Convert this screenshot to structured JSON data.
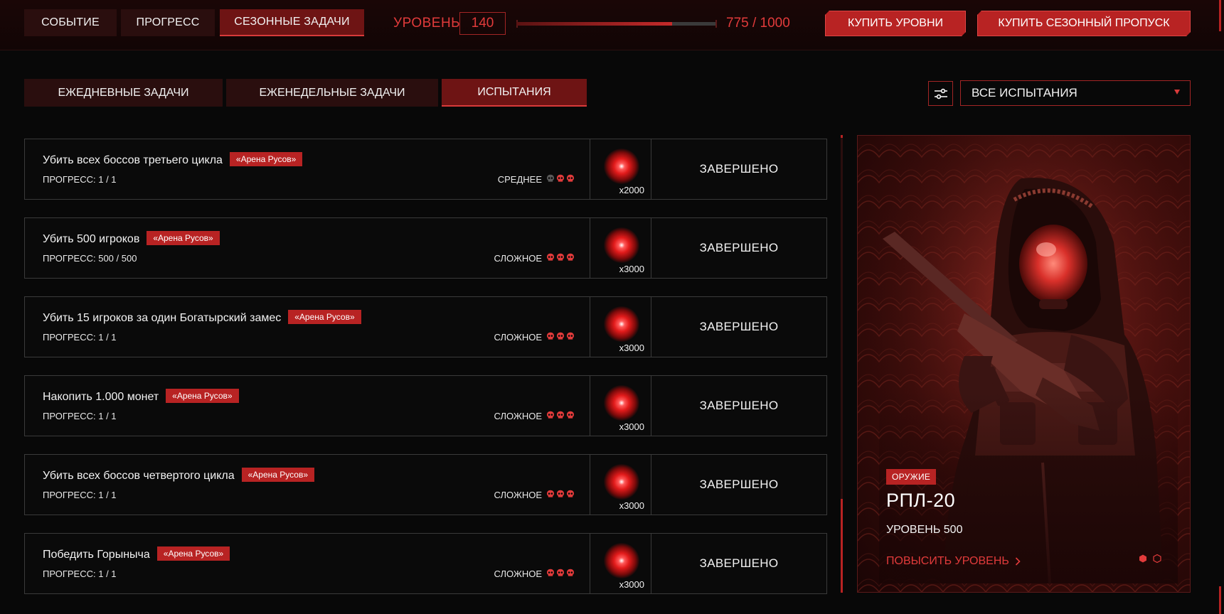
{
  "top_tabs": [
    {
      "label": "СОБЫТИЕ"
    },
    {
      "label": "ПРОГРЕСС"
    },
    {
      "label": "СЕЗОННЫЕ ЗАДАЧИ"
    }
  ],
  "level": {
    "label": "УРОВЕНЬ",
    "value": "140",
    "xp_text": "775 / 1000",
    "xp_fraction": 0.775
  },
  "buy_buttons": {
    "levels": "КУПИТЬ УРОВНИ",
    "pass": "КУПИТЬ СЕЗОННЫЙ ПРОПУСК"
  },
  "sub_tabs": [
    {
      "label": "ЕЖЕДНЕВНЫЕ ЗАДАЧИ"
    },
    {
      "label": "ЕЖЕНЕДЕЛЬНЫЕ ЗАДАЧИ"
    },
    {
      "label": "ИСПЫТАНИЯ"
    }
  ],
  "filter": {
    "icon": "sliders-icon",
    "dropdown_value": "ВСЕ ИСПЫТАНИЯ"
  },
  "tasks": [
    {
      "title": "Убить всех боссов третьего цикла",
      "tag": "«Арена Русов»",
      "progress": "ПРОГРЕСС: 1 / 1",
      "difficulty": "СРЕДНЕЕ",
      "skulls_filled": 2,
      "reward": "x2000",
      "status": "ЗАВЕРШЕНО"
    },
    {
      "title": "Убить 500 игроков",
      "tag": "«Арена Русов»",
      "progress": "ПРОГРЕСС: 500 / 500",
      "difficulty": "СЛОЖНОЕ",
      "skulls_filled": 3,
      "reward": "x3000",
      "status": "ЗАВЕРШЕНО"
    },
    {
      "title": "Убить 15 игроков за один Богатырский замес",
      "tag": "«Арена Русов»",
      "progress": "ПРОГРЕСС: 1 / 1",
      "difficulty": "СЛОЖНОЕ",
      "skulls_filled": 3,
      "reward": "x3000",
      "status": "ЗАВЕРШЕНО"
    },
    {
      "title": "Накопить 1.000 монет",
      "tag": "«Арена Русов»",
      "progress": "ПРОГРЕСС: 1 / 1",
      "difficulty": "СЛОЖНОЕ",
      "skulls_filled": 3,
      "reward": "x3000",
      "status": "ЗАВЕРШЕНО"
    },
    {
      "title": "Убить всех боссов четвертого цикла",
      "tag": "«Арена Русов»",
      "progress": "ПРОГРЕСС: 1 / 1",
      "difficulty": "СЛОЖНОЕ",
      "skulls_filled": 3,
      "reward": "x3000",
      "status": "ЗАВЕРШЕНО"
    },
    {
      "title": "Победить Горыныча",
      "tag": "«Арена Русов»",
      "progress": "ПРОГРЕСС: 1 / 1",
      "difficulty": "СЛОЖНОЕ",
      "skulls_filled": 3,
      "reward": "x3000",
      "status": "ЗАВЕРШЕНО"
    }
  ],
  "promo": {
    "badge": "ОРУЖИЕ",
    "name": "РПЛ-20",
    "level": "УРОВЕНЬ 500",
    "link": "ПОВЫСИТЬ УРОВЕНЬ",
    "slides": 2,
    "active_slide": 1
  },
  "colors": {
    "accent": "#b82323",
    "accent_text": "#e23b3b",
    "tab_bg": "#2a0e0e",
    "tab_active": "#6e1414"
  }
}
